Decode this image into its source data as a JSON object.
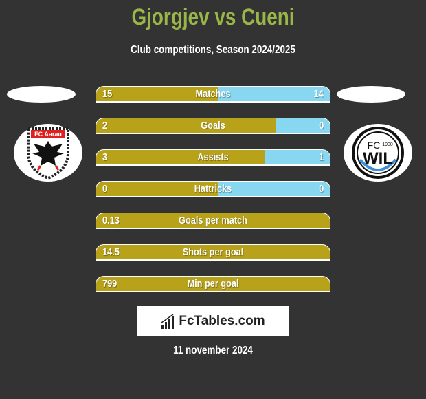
{
  "header": {
    "title": "Gjorgjev vs Cueni",
    "subtitle": "Club competitions, Season 2024/2025"
  },
  "colors": {
    "title": "#9ab648",
    "left_bar": "#b8a21a",
    "right_bar": "#87d7f0",
    "background": "#333333"
  },
  "teams": {
    "left": {
      "logo": "fc-aarau-crest-icon",
      "name_text": "FC Aarau"
    },
    "right": {
      "logo": "fc-wil-1900-crest-icon",
      "name_text": "FC WIL 1900"
    }
  },
  "stats": [
    {
      "label": "Matches",
      "left": "15",
      "right": "14",
      "left_share": 0.52
    },
    {
      "label": "Goals",
      "left": "2",
      "right": "0",
      "left_share": 0.77
    },
    {
      "label": "Assists",
      "left": "3",
      "right": "1",
      "left_share": 0.72
    },
    {
      "label": "Hattricks",
      "left": "0",
      "right": "0",
      "left_share": 0.52
    },
    {
      "label": "Goals per match",
      "left": "0.13",
      "right": "",
      "left_share": 1.0
    },
    {
      "label": "Shots per goal",
      "left": "14.5",
      "right": "",
      "left_share": 1.0
    },
    {
      "label": "Min per goal",
      "left": "799",
      "right": "",
      "left_share": 1.0
    }
  ],
  "footer": {
    "brand": "FcTables.com",
    "brand_icon": "bar-chart-icon",
    "date": "11 november 2024"
  }
}
